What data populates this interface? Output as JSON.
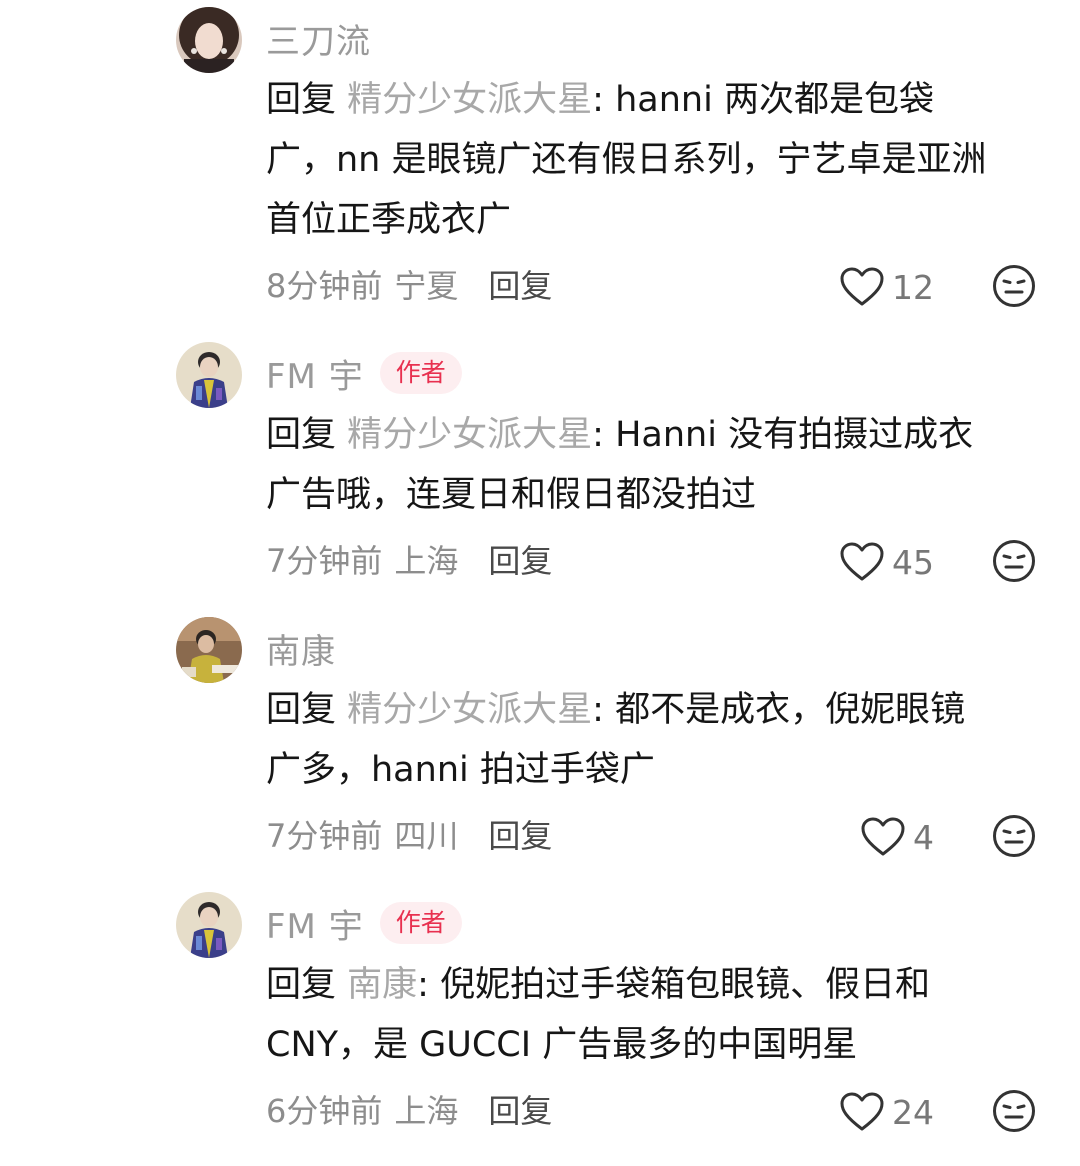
{
  "comments": [
    {
      "username": "三刀流",
      "is_author": false,
      "reply_prefix": "回复",
      "reply_to": "精分少女派大星",
      "text_lines": [
        "hanni 两次都是包袋",
        "广，nn 是眼镜广还有假日系列，宁艺卓是亚洲",
        "首位正季成衣广"
      ],
      "time": "8分钟前",
      "location": "宁夏",
      "reply_label": "回复",
      "likes": "12",
      "avatar_icon": "avatar-woman-icon"
    },
    {
      "username": "FM 宇",
      "is_author": true,
      "badge": "作者",
      "reply_prefix": "回复",
      "reply_to": "精分少女派大星",
      "text_lines": [
        "Hanni 没有拍摄过成衣",
        "广告哦，连夏日和假日都没拍过"
      ],
      "time": "7分钟前",
      "location": "上海",
      "reply_label": "回复",
      "likes": "45",
      "avatar_icon": "avatar-man-icon"
    },
    {
      "username": "南康",
      "is_author": false,
      "reply_prefix": "回复",
      "reply_to": "精分少女派大星",
      "text_lines": [
        "都不是成衣，倪妮眼镜",
        "广多，hanni 拍过手袋广"
      ],
      "time": "7分钟前",
      "location": "四川",
      "reply_label": "回复",
      "likes": "4",
      "avatar_icon": "avatar-man-icon"
    },
    {
      "username": "FM 宇",
      "is_author": true,
      "badge": "作者",
      "reply_prefix": "回复",
      "reply_to": "南康",
      "text_lines": [
        "倪妮拍过手袋箱包眼镜、假日和",
        "CNY，是 GUCCI 广告最多的中国明星"
      ],
      "time": "6分钟前",
      "location": "上海",
      "reply_label": "回复",
      "likes": "24",
      "avatar_icon": "avatar-man-icon"
    }
  ],
  "colors": {
    "username": "#9a9a9a",
    "reply_target": "#a8a8a8",
    "body": "#161616",
    "author_badge_text": "#e8304f",
    "author_badge_bg": "#fdeef0"
  }
}
